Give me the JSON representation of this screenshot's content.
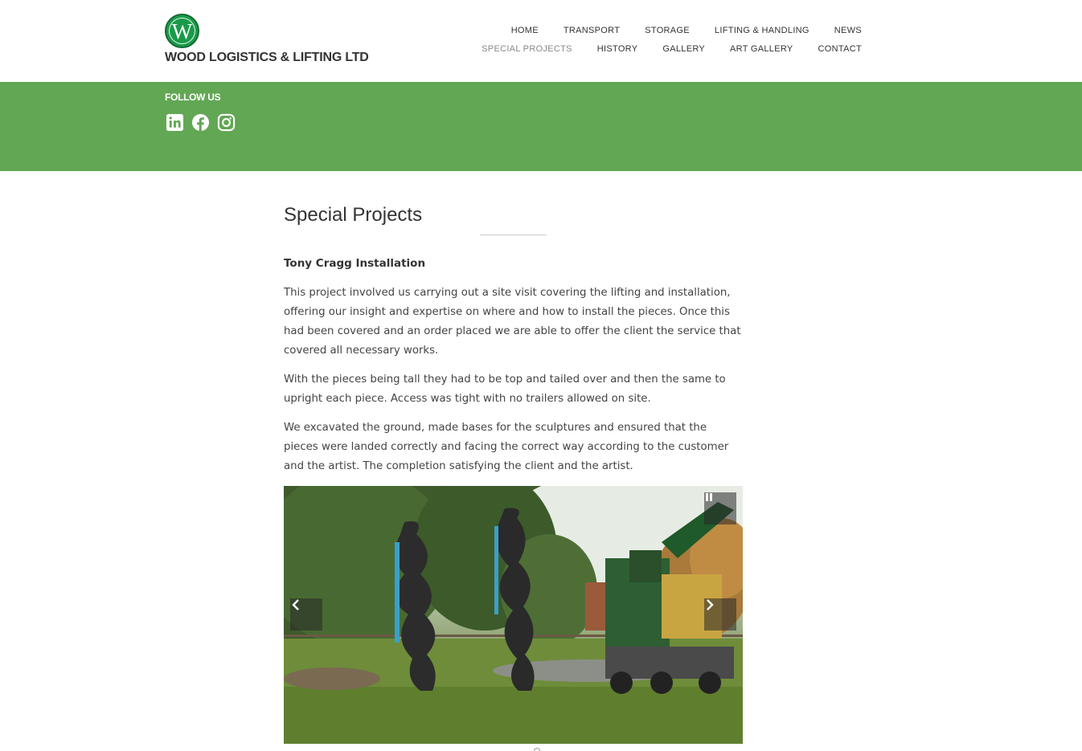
{
  "site": {
    "logo_letter": "W",
    "name": "WOOD LOGISTICS & LIFTING LTD",
    "brand_green": "#62a754"
  },
  "nav": {
    "row1": [
      "HOME",
      "TRANSPORT",
      "STORAGE",
      "LIFTING & HANDLING",
      "NEWS"
    ],
    "row2": [
      "SPECIAL PROJECTS",
      "HISTORY",
      "GALLERY",
      "ART GALLERY",
      "CONTACT"
    ],
    "active": "SPECIAL PROJECTS"
  },
  "band": {
    "follow_label": "FOLLOW US",
    "socials": [
      "linkedin-icon",
      "facebook-icon",
      "instagram-icon"
    ]
  },
  "main": {
    "title": "Special Projects",
    "subtitle": "Tony Cragg Installation",
    "paragraphs": [
      "This project involved us carrying out a site visit covering the lifting and installation, offering our insight and expertise on where and how to install the pieces. Once this had been covered and an order placed we are able to offer the client the service that covered all necessary works.",
      "With the pieces being tall they had to be top and tailed over and then the same to upright each piece. Access was tight with no trailers allowed on site.",
      "We excavated the ground, made bases for the sculptures and ensured that the pieces were landed correctly and facing the correct way according to the customer and the artist. The completion satisfying the client and the artist."
    ]
  },
  "slider": {
    "controls": [
      "pause-icon",
      "chevron-left-icon",
      "chevron-right-icon"
    ]
  }
}
